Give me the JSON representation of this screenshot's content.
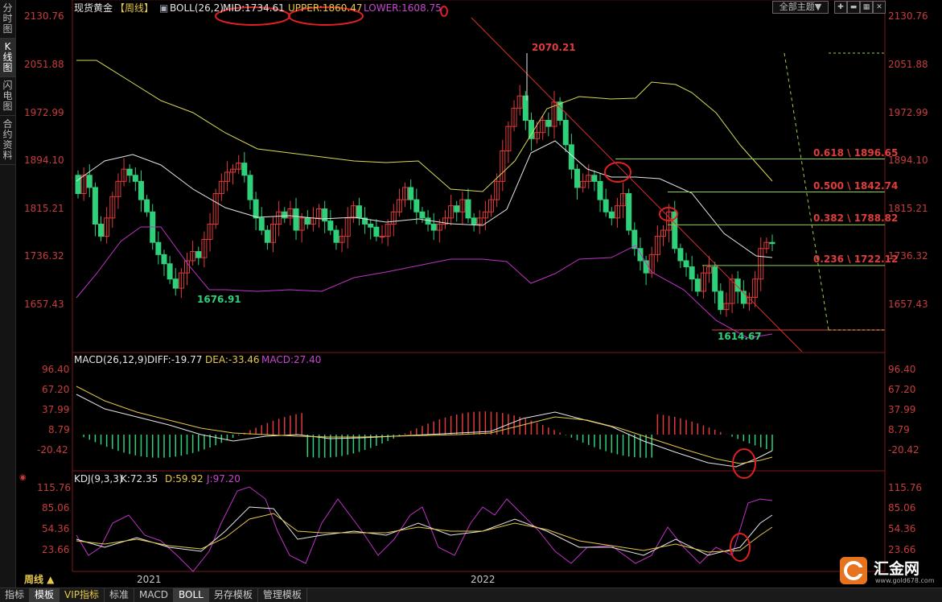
{
  "left_tabs": [
    "分\n时\n图",
    "K\n线\n图",
    "闪\n电\n图",
    "合\n约\n资\n料"
  ],
  "main": {
    "title": "现货黄金",
    "period_tag": "【周线】",
    "boll_label": "BOLL(26,2)",
    "mid": "MID:1734.61",
    "upper": "UPPER:1860.47",
    "lower": "LOWER:1608.75",
    "y_ticks": [
      "2130.76",
      "2051.88",
      "1972.99",
      "1894.10",
      "1815.21",
      "1736.32",
      "1657.43"
    ],
    "annotations": {
      "high": "2070.21",
      "low_2021": "1676.91",
      "low_2022": "1614.67"
    },
    "fib": [
      {
        "label": "0.618 \\ 1896.65",
        "level": 1896.65
      },
      {
        "label": "0.500 \\ 1842.74",
        "level": 1842.74
      },
      {
        "label": "0.382 \\ 1788.82",
        "level": 1788.82
      },
      {
        "label": "0.236 \\ 1722.12",
        "level": 1722.12
      }
    ]
  },
  "macd": {
    "label": "MACD(26,12,9)",
    "diff": "DIFF:-19.77",
    "dea": "DEA:-33.46",
    "macd": "MACD:27.40",
    "y_ticks": [
      "96.40",
      "67.20",
      "37.99",
      "8.79",
      "-20.42"
    ]
  },
  "kdj": {
    "label": "KDJ(9,3,3)",
    "k": "K:72.35",
    "d": "D:59.92",
    "j": "J:97.20",
    "y_ticks": [
      "115.76",
      "85.06",
      "54.36",
      "23.66"
    ]
  },
  "x_ticks": [
    "2021",
    "2022"
  ],
  "period_button": "周线 ▲",
  "theme_button": "全部主题▼",
  "bottom_tabs": [
    "指标",
    "模板",
    "VIP指标",
    "标准",
    "MACD",
    "BOLL",
    "另存模板",
    "管理模板"
  ],
  "logo": {
    "name": "汇金网",
    "url": "www.gold678.com"
  },
  "colors": {
    "up": "#e23a3a",
    "down": "#2fd07a",
    "upper_band": "#d9d95a",
    "mid_band": "#e6e6e6",
    "lower_band": "#c032c8",
    "fib_line": "#8fd04a",
    "text_red": "#e03c3c"
  }
}
